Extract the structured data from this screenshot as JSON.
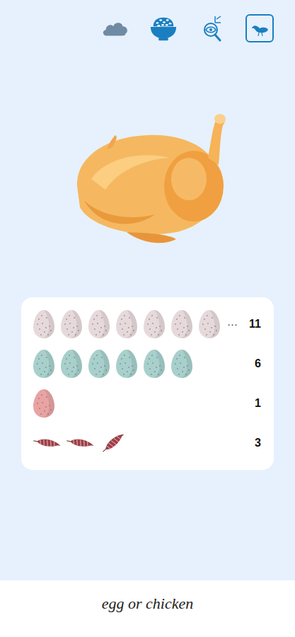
{
  "nav": [
    {
      "selected": false
    },
    {
      "selected": false
    },
    {
      "selected": false
    },
    {
      "selected": true
    }
  ],
  "inventory": [
    {
      "kind": "egg",
      "shown": 7,
      "more": "···",
      "count": "11",
      "color": "#e6d9dc"
    },
    {
      "kind": "egg",
      "shown": 6,
      "more": "",
      "count": "6",
      "color": "#a7d0cc"
    },
    {
      "kind": "egg",
      "shown": 1,
      "more": "",
      "count": "1",
      "color": "#e8a3a3"
    },
    {
      "kind": "feather",
      "shown": 3,
      "more": "",
      "count": "3",
      "color": "#9e3f47"
    }
  ],
  "footer": {
    "title": "egg or chicken"
  }
}
